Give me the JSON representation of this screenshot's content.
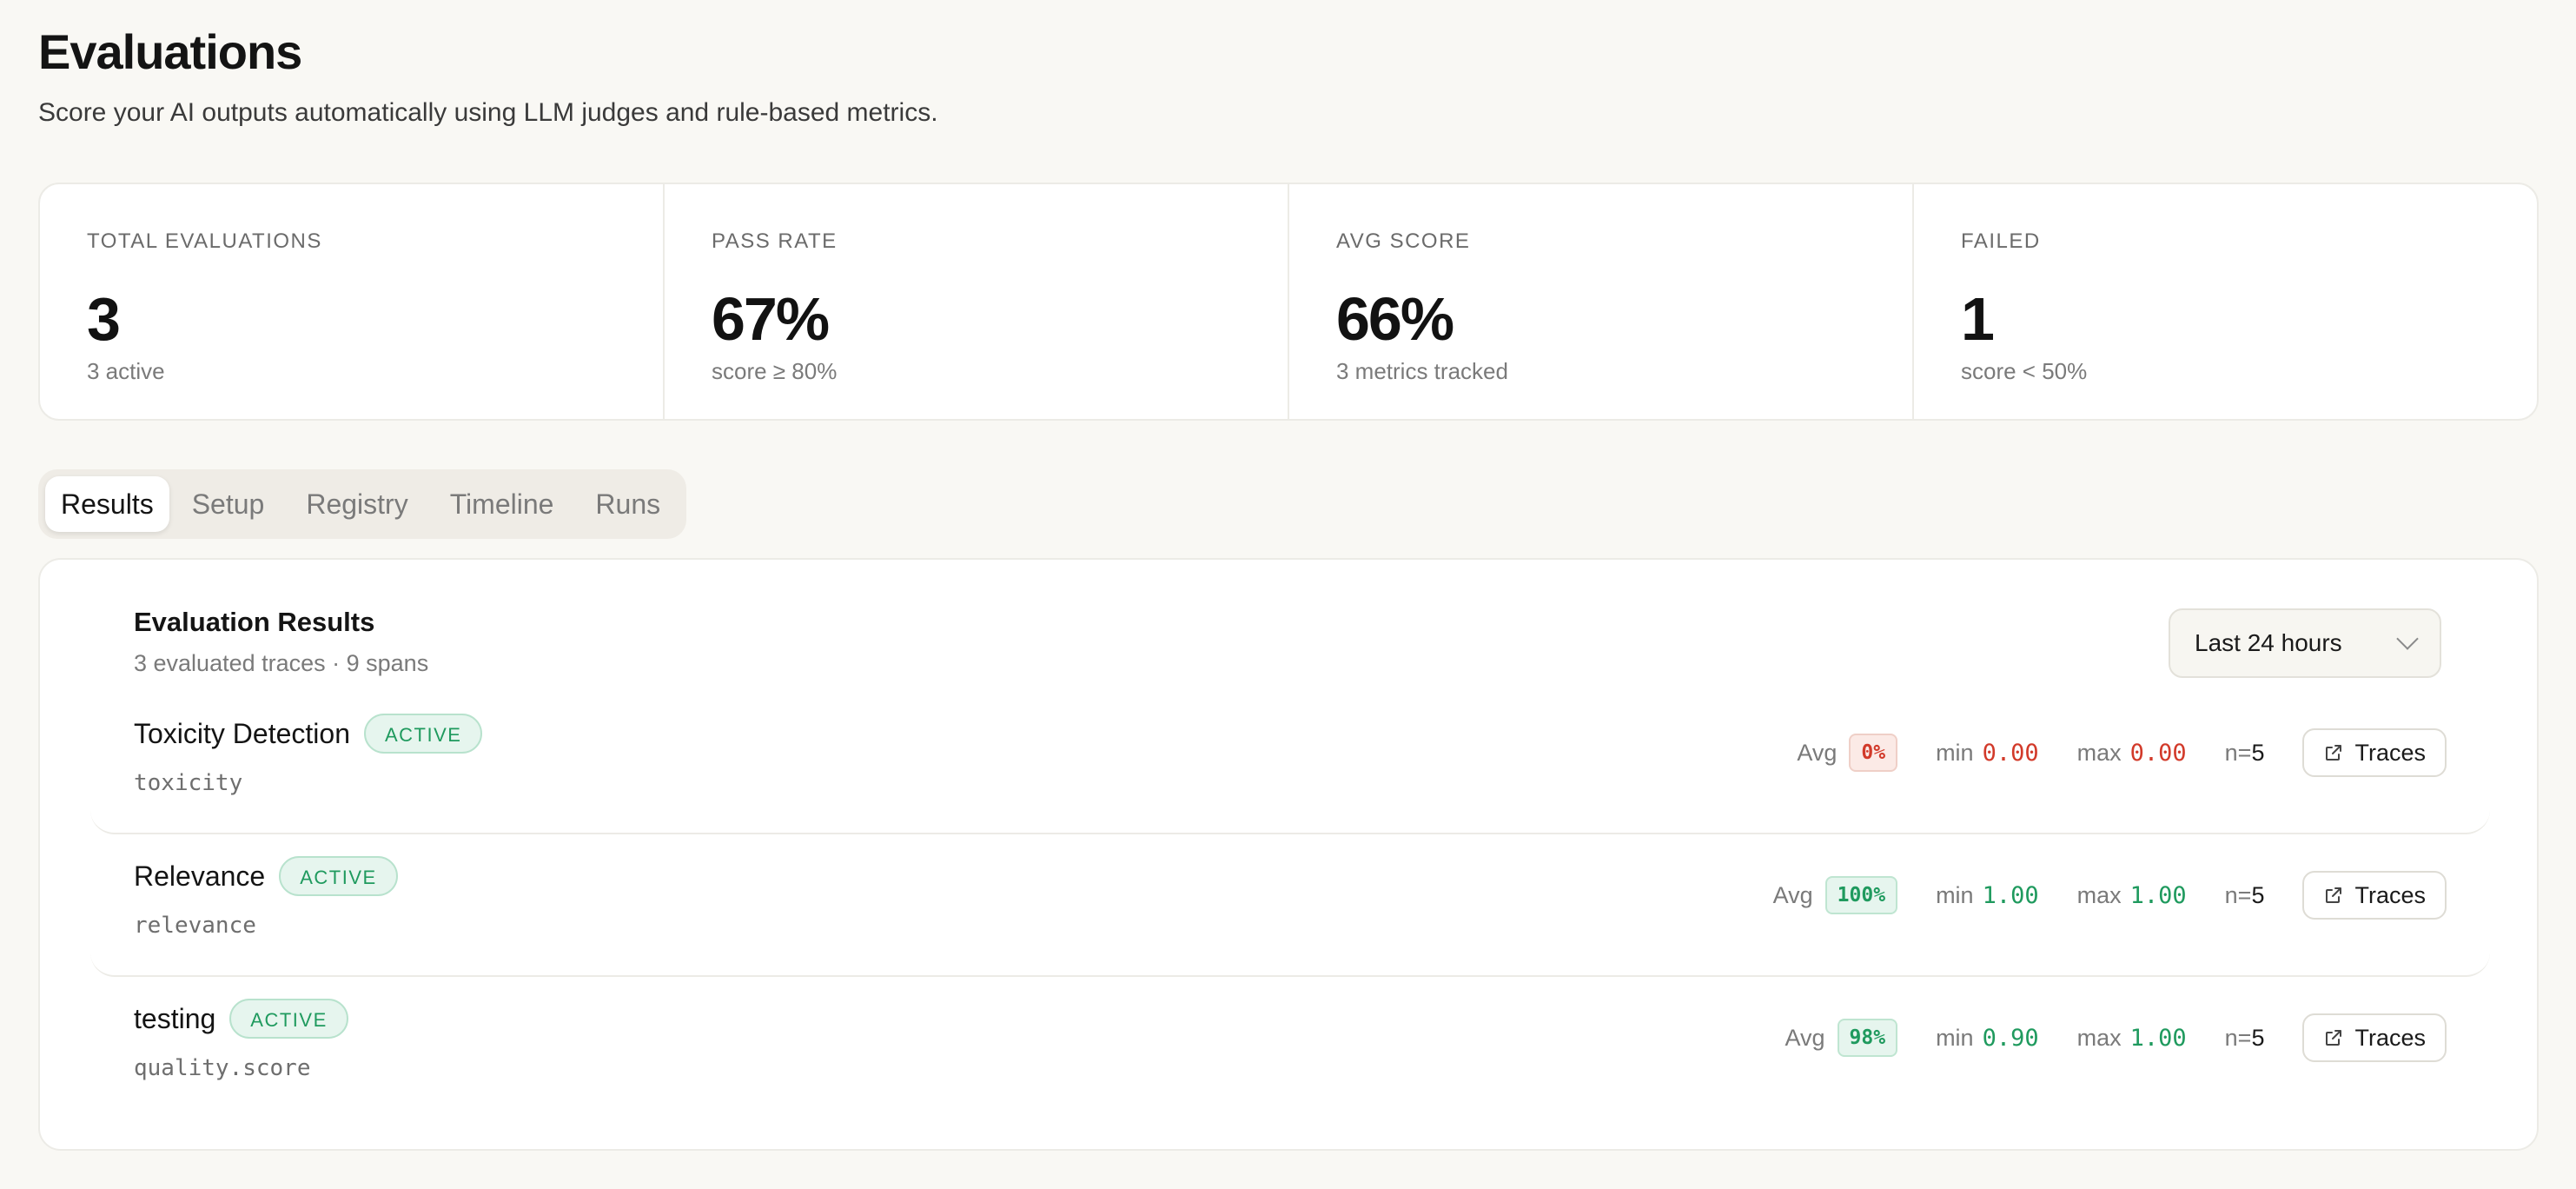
{
  "header": {
    "title": "Evaluations",
    "subtitle": "Score your AI outputs automatically using LLM judges and rule-based metrics."
  },
  "stats": [
    {
      "label": "TOTAL EVALUATIONS",
      "value": "3",
      "sub": "3 active"
    },
    {
      "label": "PASS RATE",
      "value": "67%",
      "sub": "score ≥ 80%"
    },
    {
      "label": "AVG SCORE",
      "value": "66%",
      "sub": "3 metrics tracked"
    },
    {
      "label": "FAILED",
      "value": "1",
      "sub": "score < 50%"
    }
  ],
  "tabs": [
    {
      "label": "Results",
      "active": true
    },
    {
      "label": "Setup",
      "active": false
    },
    {
      "label": "Registry",
      "active": false
    },
    {
      "label": "Timeline",
      "active": false
    },
    {
      "label": "Runs",
      "active": false
    }
  ],
  "results": {
    "title": "Evaluation Results",
    "subtitle": "3 evaluated traces · 9 spans",
    "range": "Last 24 hours",
    "labels": {
      "avg": "Avg",
      "min": "min",
      "max": "max",
      "n_prefix": "n=",
      "traces": "Traces"
    },
    "metrics": [
      {
        "name": "Toxicity Detection",
        "status": "ACTIVE",
        "key": "toxicity",
        "avg": "0%",
        "min": "0.00",
        "max": "0.00",
        "n": "5",
        "tone": "bad"
      },
      {
        "name": "Relevance",
        "status": "ACTIVE",
        "key": "relevance",
        "avg": "100%",
        "min": "1.00",
        "max": "1.00",
        "n": "5",
        "tone": "good"
      },
      {
        "name": "testing",
        "status": "ACTIVE",
        "key": "quality.score",
        "avg": "98%",
        "min": "0.90",
        "max": "1.00",
        "n": "5",
        "tone": "good"
      }
    ]
  },
  "colors": {
    "good": "#1f9a5e",
    "bad": "#d23a2a",
    "background": "#f9f8f4"
  }
}
